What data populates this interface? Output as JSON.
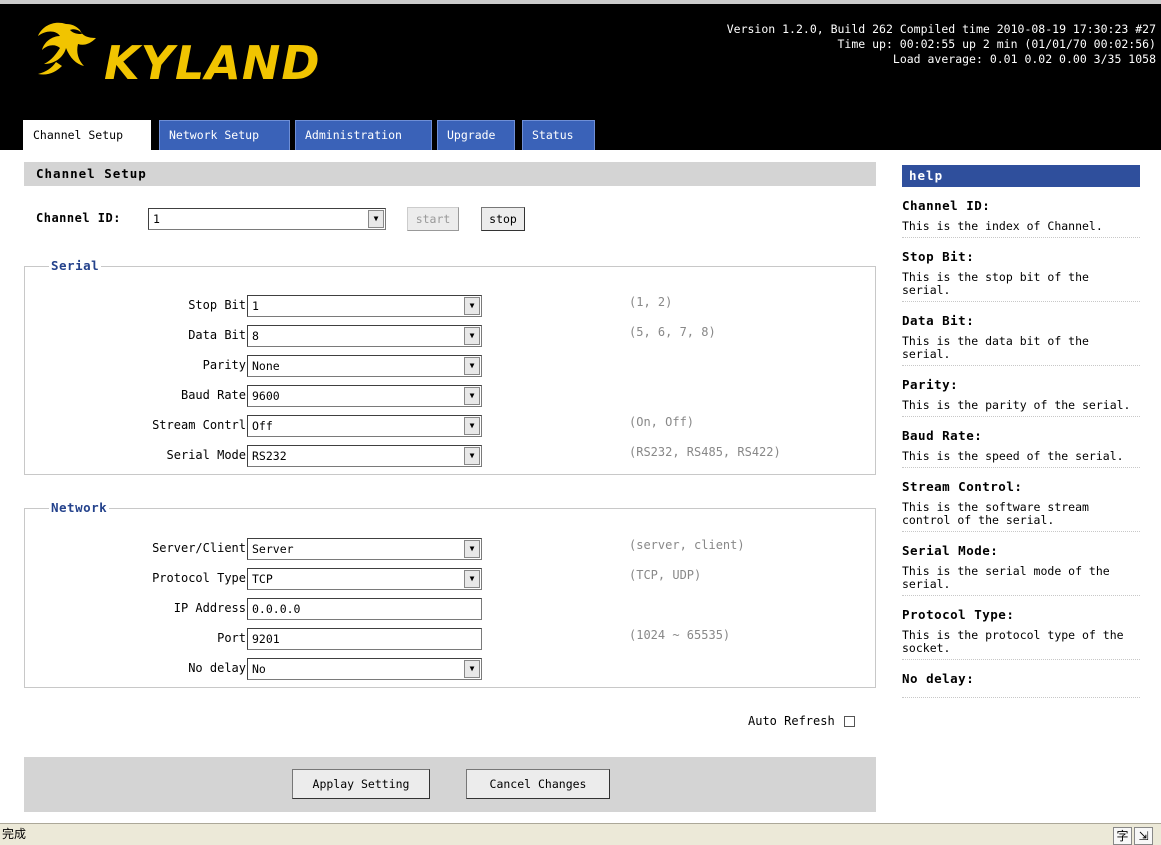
{
  "brand": {
    "logo_text": "KYLAND"
  },
  "system_info": {
    "line1": "Version 1.2.0, Build 262 Compiled time 2010-08-19 17:30:23 #27",
    "line2": "Time up: 00:02:55 up 2 min (01/01/70 00:02:56)",
    "line3": "Load average: 0.01 0.02 0.00 3/35 1058"
  },
  "tabs": [
    {
      "label": "Channel Setup",
      "active": true
    },
    {
      "label": "Network Setup",
      "active": false
    },
    {
      "label": "Administration",
      "active": false
    },
    {
      "label": "Upgrade",
      "active": false
    },
    {
      "label": "Status",
      "active": false
    }
  ],
  "panel_title": "Channel Setup",
  "channel": {
    "label": "Channel ID:",
    "value": "1",
    "start_label": "start",
    "stop_label": "stop"
  },
  "serial": {
    "legend": "Serial",
    "rows": [
      {
        "label": "Stop Bit",
        "value": "1",
        "hint": "(1, 2)"
      },
      {
        "label": "Data Bit",
        "value": "8",
        "hint": "(5, 6, 7, 8)"
      },
      {
        "label": "Parity",
        "value": "None",
        "hint": ""
      },
      {
        "label": "Baud Rate",
        "value": "9600",
        "hint": ""
      },
      {
        "label": "Stream Contrl",
        "value": "Off",
        "hint": "(On, Off)"
      },
      {
        "label": "Serial Mode",
        "value": "RS232",
        "hint": "(RS232, RS485, RS422)"
      }
    ]
  },
  "network": {
    "legend": "Network",
    "rows": [
      {
        "label": "Server/Client",
        "value": "Server",
        "hint": "(server, client)"
      },
      {
        "label": "Protocol Type",
        "value": "TCP",
        "hint": "(TCP, UDP)"
      },
      {
        "label": "IP Address",
        "value": "0.0.0.0",
        "hint": ""
      },
      {
        "label": "Port",
        "value": "9201",
        "hint": "(1024 ~ 65535)"
      },
      {
        "label": "No delay",
        "value": "No",
        "hint": ""
      }
    ]
  },
  "auto_refresh": {
    "label": "Auto Refresh",
    "checked": false
  },
  "actions": {
    "apply_label": "Applay Setting",
    "cancel_label": "Cancel Changes"
  },
  "help": {
    "title": "help",
    "items": [
      {
        "title": "Channel ID:",
        "desc": "This is the index of Channel."
      },
      {
        "title": "Stop Bit:",
        "desc": "This is the stop bit of the serial."
      },
      {
        "title": "Data Bit:",
        "desc": "This is the data bit of the serial."
      },
      {
        "title": "Parity:",
        "desc": "This is the parity of the serial."
      },
      {
        "title": "Baud Rate:",
        "desc": "This is the speed of the serial."
      },
      {
        "title": "Stream Control:",
        "desc": "This is the software stream control of the serial."
      },
      {
        "title": "Serial Mode:",
        "desc": "This is the serial mode of the serial."
      },
      {
        "title": "Protocol Type:",
        "desc": "This is the protocol type of the socket."
      },
      {
        "title": "No delay:",
        "desc": ""
      }
    ]
  },
  "statusbar": {
    "text": "完成",
    "ime_icons": [
      "字",
      "⇲"
    ]
  },
  "colors": {
    "header_bg": "#000000",
    "logo": "#f1c400",
    "tab": "#3a62b8",
    "help_title": "#2f4f9c",
    "legend": "#24428c",
    "panel_bar": "#d4d4d4"
  }
}
